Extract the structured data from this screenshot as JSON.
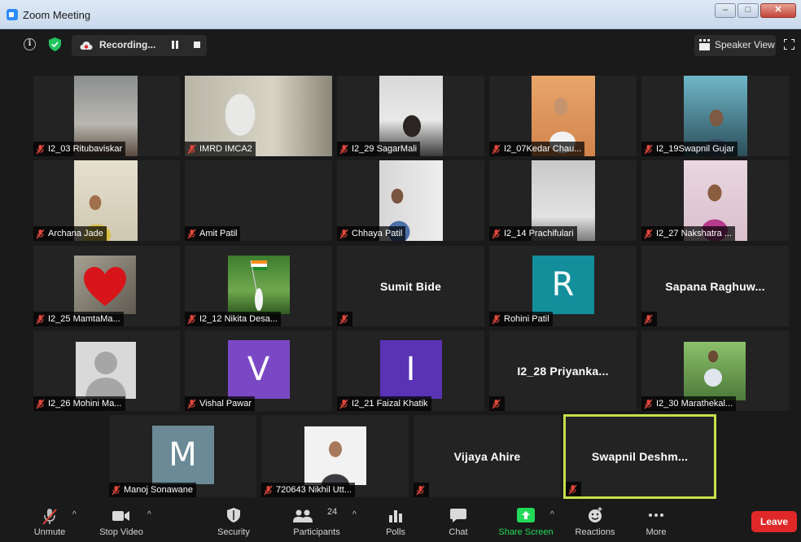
{
  "window": {
    "title": "Zoom Meeting",
    "controls": [
      "–",
      "□",
      "✕"
    ]
  },
  "topbar": {
    "recording_label": "Recording...",
    "view_label": "Speaker View"
  },
  "participants": [
    {
      "name": "I2_03 Ritubaviskar",
      "kind": "video"
    },
    {
      "name": "IMRD IMCA2",
      "kind": "video"
    },
    {
      "name": "I2_29 SagarMali",
      "kind": "video"
    },
    {
      "name": "I2_07Kedar Chau...",
      "kind": "video"
    },
    {
      "name": "I2_19Swapnil Gujar",
      "kind": "video"
    },
    {
      "name": "Archana Jade",
      "kind": "video"
    },
    {
      "name": "Amit Patil",
      "kind": "blank"
    },
    {
      "name": "Chhaya Patil",
      "kind": "video"
    },
    {
      "name": "I2_14 Prachifulari",
      "kind": "video"
    },
    {
      "name": "I2_27 Nakshatra ...",
      "kind": "video"
    },
    {
      "name": "I2_25 MamtaMa...",
      "kind": "picture"
    },
    {
      "name": "I2_12 Nikita Desa...",
      "kind": "picture"
    },
    {
      "name": "Sumit Bide",
      "kind": "name-only"
    },
    {
      "name": "Rohini Patil",
      "kind": "avatar",
      "letter": "R",
      "color": "#138f9c"
    },
    {
      "name": "Sapana  Raghuw...",
      "kind": "name-only"
    },
    {
      "name": "I2_26 Mohini Ma...",
      "kind": "default-avatar"
    },
    {
      "name": "Vishal Pawar",
      "kind": "avatar",
      "letter": "V",
      "color": "#7b48c5"
    },
    {
      "name": "I2_21 Faizal Khatik",
      "kind": "avatar",
      "letter": "I",
      "color": "#5a33b5"
    },
    {
      "name": "I2_28  Priyanka...",
      "kind": "name-only"
    },
    {
      "name": "I2_30 Marathekal...",
      "kind": "video"
    },
    {
      "name": "Manoj Sonawane",
      "kind": "avatar",
      "letter": "M",
      "color": "#6b8a96"
    },
    {
      "name": "720643 Nikhil Utt...",
      "kind": "picture"
    },
    {
      "name": "Vijaya Ahire",
      "kind": "name-only"
    },
    {
      "name": "Swapnil  Deshm...",
      "kind": "name-only",
      "active": true
    }
  ],
  "toolbar": {
    "unmute": "Unmute",
    "stop_video": "Stop Video",
    "security": "Security",
    "participants": "Participants",
    "participants_count": "24",
    "polls": "Polls",
    "chat": "Chat",
    "share_screen": "Share Screen",
    "reactions": "Reactions",
    "more": "More",
    "leave": "Leave"
  },
  "colors": {
    "share_green": "#23d959",
    "leave_red": "#e02828",
    "active_border": "#c5e04a",
    "muted_mic": "#e0473b"
  }
}
